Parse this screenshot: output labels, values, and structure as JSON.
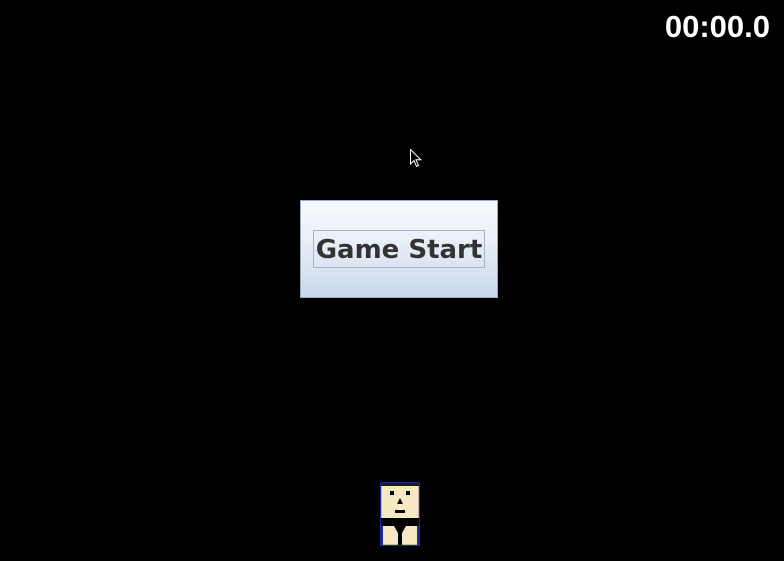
{
  "hud": {
    "timer": "00:00.0"
  },
  "start_button": {
    "label": "Game Start"
  },
  "player": {
    "icon": "player-character-icon"
  },
  "colors": {
    "background": "#000000",
    "timer_text": "#ffffff",
    "button_text": "#333333",
    "player_skin": "#f7e8c4",
    "player_outline": "#1a2a9a"
  }
}
